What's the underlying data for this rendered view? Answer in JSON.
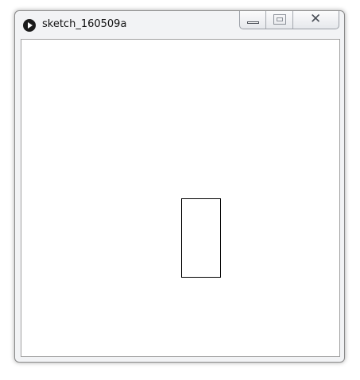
{
  "window": {
    "title": "sketch_160509a",
    "app_icon": "processing-play-icon",
    "controls": {
      "minimize_icon": "minimize-icon",
      "maximize_icon": "maximize-icon",
      "close_icon": "close-icon",
      "close_glyph": "✕"
    }
  },
  "canvas": {
    "background": "#ffffff",
    "shapes": [
      {
        "type": "rectangle",
        "stroke": "#000000",
        "fill": "#ffffff"
      }
    ]
  }
}
